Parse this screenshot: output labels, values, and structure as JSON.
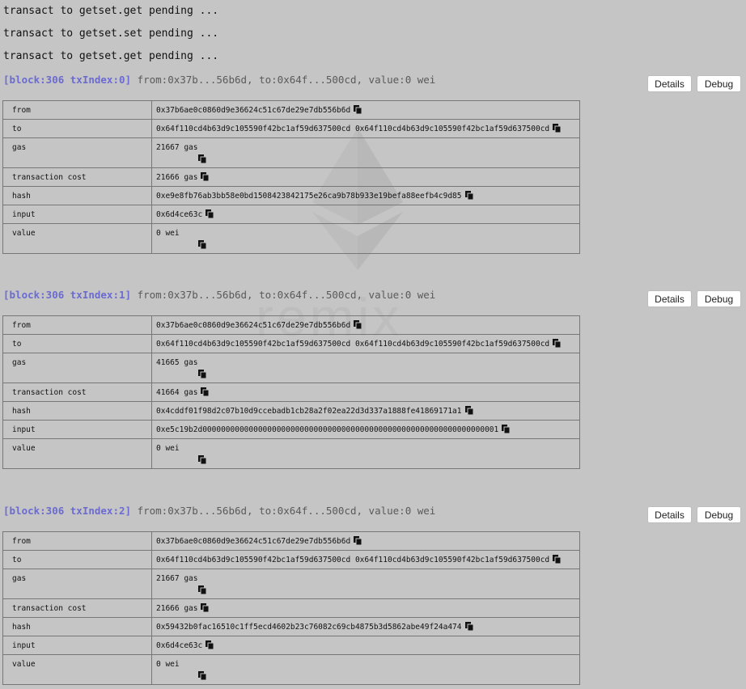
{
  "pending": [
    "transact to getset.get pending ...",
    "transact to getset.set pending ...",
    "transact to getset.get pending ..."
  ],
  "watermark": "remix",
  "buttons": {
    "details": "Details",
    "debug": "Debug"
  },
  "labels": {
    "from": "from",
    "to": "to",
    "gas": "gas",
    "transaction_cost": "transaction cost",
    "hash": "hash",
    "input": "input",
    "value": "value"
  },
  "transactions": [
    {
      "block": "[block:306 txIndex:0]",
      "summary": "from:0x37b...56b6d, to:0x64f...500cd, value:0 wei",
      "from": "0x37b6ae0c0860d9e36624c51c67de29e7db556b6d",
      "to": "0x64f110cd4b63d9c105590f42bc1af59d637500cd 0x64f110cd4b63d9c105590f42bc1af59d637500cd",
      "gas": "21667 gas",
      "transaction_cost": "21666 gas",
      "hash": "0xe9e8fb76ab3bb58e0bd1508423842175e26ca9b78b933e19befa88eefb4c9d85",
      "input": "0x6d4ce63c",
      "value": "0 wei"
    },
    {
      "block": "[block:306 txIndex:1]",
      "summary": "from:0x37b...56b6d, to:0x64f...500cd, value:0 wei",
      "from": "0x37b6ae0c0860d9e36624c51c67de29e7db556b6d",
      "to": "0x64f110cd4b63d9c105590f42bc1af59d637500cd 0x64f110cd4b63d9c105590f42bc1af59d637500cd",
      "gas": "41665 gas",
      "transaction_cost": "41664 gas",
      "hash": "0x4cddf01f98d2c07b10d9ccebadb1cb28a2f02ea22d3d337a1888fe41869171a1",
      "input": "0xe5c19b2d0000000000000000000000000000000000000000000000000000000000000001",
      "value": "0 wei"
    },
    {
      "block": "[block:306 txIndex:2]",
      "summary": "from:0x37b...56b6d, to:0x64f...500cd, value:0 wei",
      "from": "0x37b6ae0c0860d9e36624c51c67de29e7db556b6d",
      "to": "0x64f110cd4b63d9c105590f42bc1af59d637500cd 0x64f110cd4b63d9c105590f42bc1af59d637500cd",
      "gas": "21667 gas",
      "transaction_cost": "21666 gas",
      "hash": "0x59432b0fac16510c1ff5ecd4602b23c76082c69cb4875b3d5862abe49f24a474",
      "input": "0x6d4ce63c",
      "value": "0 wei"
    }
  ]
}
